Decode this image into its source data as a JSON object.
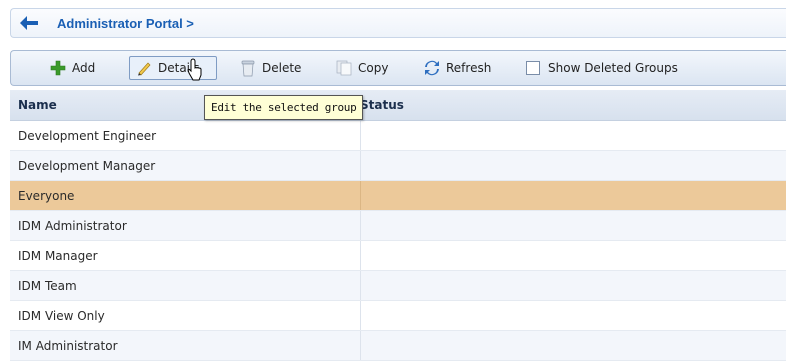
{
  "breadcrumb": {
    "label": "Administrator Portal >"
  },
  "toolbar": {
    "add_label": "Add",
    "details_label": "Details",
    "delete_label": "Delete",
    "copy_label": "Copy",
    "refresh_label": "Refresh",
    "show_deleted_label": "Show Deleted Groups",
    "show_deleted_checked": false
  },
  "tooltip": {
    "text": "Edit the selected group"
  },
  "table": {
    "columns": [
      "Name",
      "Status"
    ],
    "rows": [
      {
        "name": "Development Engineer",
        "status": ""
      },
      {
        "name": "Development Manager",
        "status": ""
      },
      {
        "name": "Everyone",
        "status": "",
        "selected": true
      },
      {
        "name": "IDM Administrator",
        "status": ""
      },
      {
        "name": "IDM Manager",
        "status": ""
      },
      {
        "name": "IDM Team",
        "status": ""
      },
      {
        "name": "IDM View Only",
        "status": ""
      },
      {
        "name": "IM Administrator",
        "status": ""
      }
    ]
  },
  "colors": {
    "accent": "#1a5fb4",
    "selected_row": "#ecc99a",
    "add_icon": "#3a9a2a",
    "refresh_icon": "#2f6fc0"
  },
  "icons": [
    "back-arrow-icon",
    "add-icon",
    "pencil-icon",
    "trash-icon",
    "copy-icon",
    "refresh-icon",
    "mouse-pointer-icon"
  ]
}
